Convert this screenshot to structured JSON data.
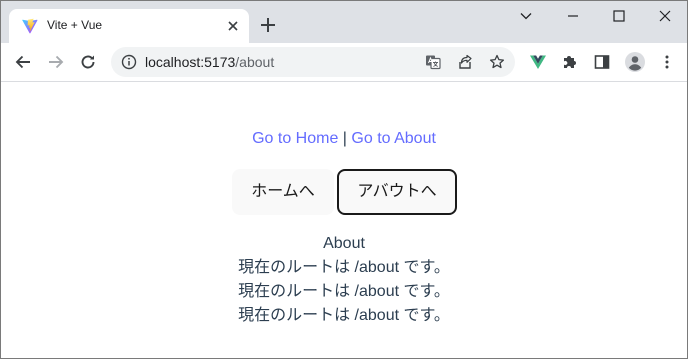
{
  "browser": {
    "tab": {
      "title": "Vite + Vue"
    },
    "address": {
      "host": "localhost:5173",
      "path": "/about"
    },
    "icons": {
      "favicon": "vite-logo-icon",
      "close": "close-icon",
      "new_tab": "plus-icon",
      "tab_search": "chevron-down-icon",
      "minimize": "minimize-icon",
      "maximize": "maximize-icon",
      "window_close": "window-close-icon",
      "back": "arrow-left-icon",
      "forward": "arrow-right-icon",
      "reload": "reload-icon",
      "site_info": "info-icon",
      "translate": "translate-icon",
      "share": "share-icon",
      "bookmark": "star-icon",
      "vue_devtools": "vue-logo-icon",
      "extensions": "puzzle-icon",
      "side_panel": "side-panel-icon",
      "profile": "profile-icon",
      "menu": "kebab-menu-icon"
    }
  },
  "page": {
    "links": {
      "home": "Go to Home",
      "separator": "|",
      "about": "Go to About"
    },
    "buttons": {
      "home": "ホームへ",
      "about": "アバウトへ"
    },
    "about": {
      "title": "About",
      "lines": [
        "現在のルートは /about です。",
        "現在のルートは /about です。",
        "現在のルートは /about です。"
      ]
    }
  },
  "colors": {
    "link": "#646cff",
    "text": "#2c3e50",
    "button_bg": "#f9f9f9",
    "tabstrip_bg": "#dee1e6",
    "omnibox_bg": "#f1f3f4",
    "vue_green": "#41b883",
    "vue_dark": "#34495e"
  }
}
